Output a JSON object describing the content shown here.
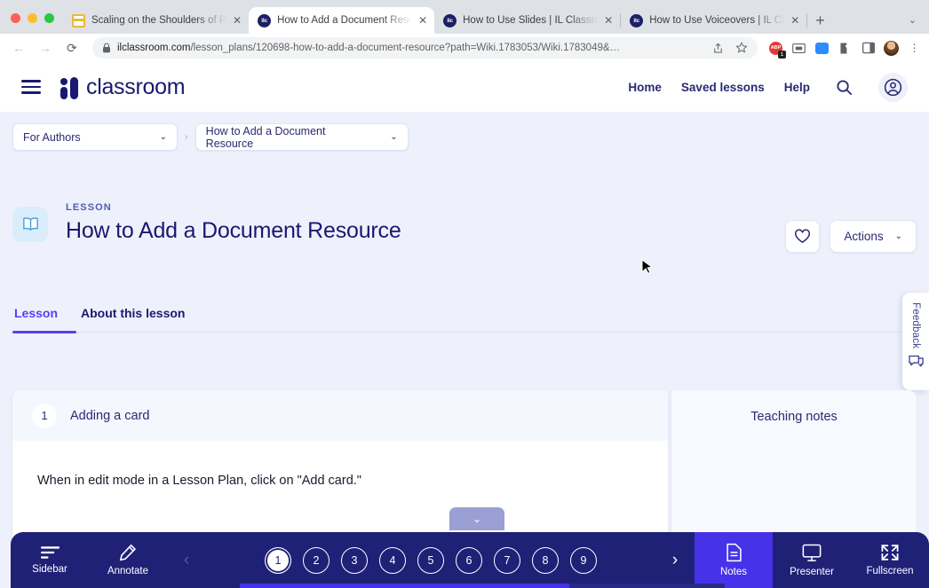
{
  "browser": {
    "tabs": [
      {
        "title": "Scaling on the Shoulders of Pa",
        "favicon": "sheets-icon",
        "active": false
      },
      {
        "title": "How to Add a Document Resou",
        "favicon": "ilc-icon",
        "active": true
      },
      {
        "title": "How to Use Slides | IL Classroo",
        "favicon": "ilc-icon",
        "active": false
      },
      {
        "title": "How to Use Voiceovers | IL Cla",
        "favicon": "ilc-icon",
        "active": false
      }
    ],
    "new_tab_label": "+",
    "tab_list_caret": "⌄",
    "close_label": "✕",
    "back_label": "←",
    "forward_label": "→",
    "reload_label": "⟳",
    "url_domain": "ilclassroom.com",
    "url_path": "/lesson_plans/120698-how-to-add-a-document-resource?path=Wiki.1783053/Wiki.1783049&…",
    "lock_icon": "lock-icon",
    "share_icon": "share-icon",
    "bookmark_icon": "star-icon",
    "extensions": [
      "adblock-icon",
      "screenshot-icon",
      "zoom-icon",
      "puzzle-icon",
      "sidepanel-icon"
    ],
    "adblock_badge": "1",
    "menu_icon": "⋮"
  },
  "app_header": {
    "menu_icon": "hamburger-icon",
    "brand": "classroom",
    "nav": [
      {
        "label": "Home"
      },
      {
        "label": "Saved lessons"
      },
      {
        "label": "Help"
      }
    ],
    "search_icon": "search-icon",
    "account_icon": "account-icon"
  },
  "breadcrumb": {
    "items": [
      {
        "label": "For Authors"
      },
      {
        "label": "How to Add a Document Resource"
      }
    ],
    "separator": "›",
    "chevron": "⌄"
  },
  "lesson": {
    "eyebrow": "LESSON",
    "title": "How to Add a Document Resource",
    "icon": "book-icon",
    "favorite_icon": "heart-icon",
    "actions_label": "Actions",
    "actions_chevron": "⌄"
  },
  "tabs": {
    "items": [
      {
        "label": "Lesson",
        "active": true
      },
      {
        "label": "About this lesson",
        "active": false
      }
    ]
  },
  "feedback": {
    "label": "Feedback",
    "icon": "speech-bubble-icon"
  },
  "card": {
    "number": "1",
    "heading": "Adding a card",
    "body": "When in edit mode in a Lesson Plan, click on \"Add card.\"",
    "scroll_chevron": "⌄"
  },
  "notes": {
    "title": "Teaching notes"
  },
  "toolbar": {
    "sidebar_label": "Sidebar",
    "sidebar_icon": "lines-icon",
    "annotate_label": "Annotate",
    "annotate_icon": "pencil-icon",
    "prev_label": "‹",
    "next_label": "›",
    "pages": [
      "1",
      "2",
      "3",
      "4",
      "5",
      "6",
      "7",
      "8",
      "9"
    ],
    "active_page": "1",
    "notes_label": "Notes",
    "notes_icon": "document-icon",
    "presenter_label": "Presenter",
    "presenter_icon": "monitor-icon",
    "fullscreen_label": "Fullscreen",
    "fullscreen_icon": "expand-icon",
    "progress_percent": 68
  },
  "colors": {
    "brand_navy": "#191970",
    "accent_purple": "#5b3df5",
    "toolbar_navy": "#1e2176",
    "toolbar_accent": "#4632e8",
    "page_bg": "#eef1fb"
  }
}
